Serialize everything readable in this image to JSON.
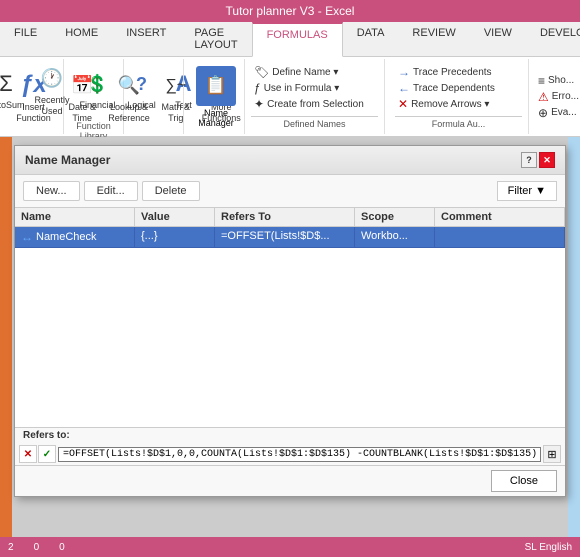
{
  "app": {
    "title": "Tutor planner V3 - Excel"
  },
  "ribbon": {
    "tabs": [
      "FILE",
      "HOME",
      "INSERT",
      "PAGE LAYOUT",
      "FORMULAS",
      "DATA",
      "REVIEW",
      "VIEW",
      "DEVELOPER"
    ],
    "active_tab": "FORMULAS",
    "groups": {
      "function_library": {
        "label": "Function Library",
        "buttons": [
          {
            "label": "Insert\nFunction",
            "icon": "fx"
          },
          {
            "label": "AutoSum",
            "icon": "Σ"
          },
          {
            "label": "Recently\nUsed",
            "icon": "⏱"
          },
          {
            "label": "Financial",
            "icon": "💰"
          },
          {
            "label": "Logical",
            "icon": "?"
          },
          {
            "label": "Text",
            "icon": "A"
          },
          {
            "label": "Date &\nTime",
            "icon": "📅"
          },
          {
            "label": "Lookup &\nReference",
            "icon": "🔍"
          },
          {
            "label": "Math &\nTrig",
            "icon": "∑~"
          },
          {
            "label": "More\nFunctions",
            "icon": "···"
          }
        ]
      },
      "defined_names": {
        "label": "Defined Names",
        "buttons": [
          {
            "label": "Name\nManager",
            "icon": "📋"
          },
          {
            "label": "Define Name",
            "icon": "🏷"
          },
          {
            "label": "Use in Formula",
            "icon": "ƒ"
          },
          {
            "label": "Create from Selection",
            "icon": "✦"
          }
        ]
      },
      "formula_auditing": {
        "label": "Formula Au...",
        "buttons": [
          {
            "label": "Trace Precedents",
            "icon": "→"
          },
          {
            "label": "Trace Dependents",
            "icon": "←"
          },
          {
            "label": "Remove Arrows",
            "icon": "✕→"
          },
          {
            "label": "Show Formulas",
            "icon": "≡"
          },
          {
            "label": "Error Checking",
            "icon": "⚠"
          },
          {
            "label": "Evaluate Formula",
            "icon": "≈"
          }
        ]
      }
    }
  },
  "dialog": {
    "title": "Name Manager",
    "buttons": {
      "new": "New...",
      "edit": "Edit...",
      "delete": "Delete",
      "filter": "Filter ▼",
      "close": "Close"
    },
    "table": {
      "columns": [
        "Name",
        "Value",
        "Refers To",
        "Scope",
        "Comment"
      ],
      "rows": [
        {
          "selected": true,
          "indicator": "↔",
          "name": "NameCheck",
          "value": "{...}",
          "refers_to": "=OFFSET(Lists!$D$...",
          "scope": "Workbo...",
          "comment": ""
        }
      ]
    },
    "refers_to": {
      "label": "Refers to:",
      "value": "=OFFSET(Lists!$D$1,0,0,COUNTA(Lists!$D$1:$D$135) -COUNTBLANK(Lists!$D$1:$D$135),1)"
    }
  },
  "status_bar": {
    "numbers": [
      "2",
      "0",
      "0"
    ],
    "locale": "SL English"
  }
}
